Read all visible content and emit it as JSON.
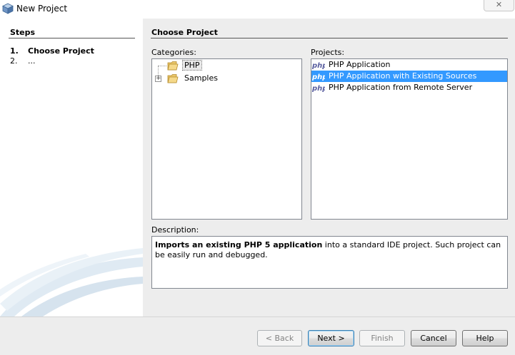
{
  "window": {
    "title": "New Project",
    "close_label": "✕"
  },
  "steps": {
    "title": "Steps",
    "items": [
      {
        "num": "1.",
        "label": "Choose Project"
      },
      {
        "num": "2.",
        "label": "..."
      }
    ]
  },
  "main": {
    "title": "Choose Project",
    "categories_label": "Categories:",
    "projects_label": "Projects:",
    "description_label": "Description:",
    "categories": [
      {
        "label": "PHP",
        "selected": true,
        "expandable": false
      },
      {
        "label": "Samples",
        "selected": false,
        "expandable": true
      }
    ],
    "projects": [
      {
        "label": "PHP Application",
        "selected": false
      },
      {
        "label": "PHP Application with Existing Sources",
        "selected": true
      },
      {
        "label": "PHP Application from Remote Server",
        "selected": false
      }
    ],
    "description": {
      "bold": "Imports an existing PHP 5 application",
      "rest": " into a standard IDE project. Such project can be easily run and debugged."
    }
  },
  "buttons": {
    "back": "< Back",
    "next": "Next >",
    "finish": "Finish",
    "cancel": "Cancel",
    "help": "Help"
  },
  "colors": {
    "selection": "#3399ff",
    "accent_border": "#3c7fb1"
  },
  "icons": {
    "app": "netbeans-cube-icon",
    "folder": "folder-icon",
    "php": "php-icon",
    "expander": "plus-expander-icon"
  }
}
